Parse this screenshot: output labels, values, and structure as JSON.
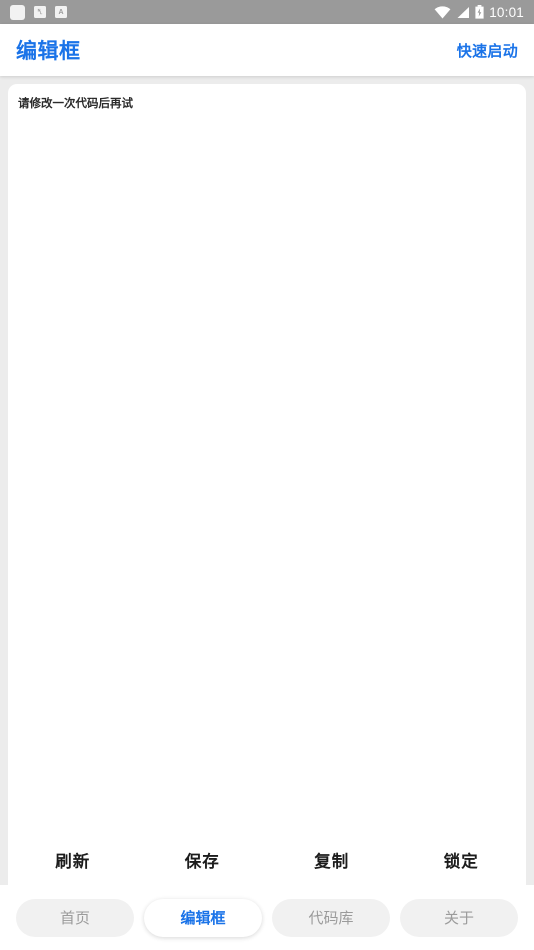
{
  "status_bar": {
    "background_color": "#9a9a9a",
    "time": "10:01",
    "left_icons": [
      {
        "name": "app-notification-icon",
        "glyph": ""
      },
      {
        "name": "keyboard-notification-icon",
        "glyph": "⌨"
      },
      {
        "name": "text-input-notification-icon",
        "glyph": "A"
      }
    ],
    "right_icons": [
      {
        "name": "wifi-icon"
      },
      {
        "name": "cellular-signal-icon"
      },
      {
        "name": "battery-charging-icon"
      }
    ]
  },
  "header": {
    "title": "编辑框",
    "quick_launch_label": "快速启动",
    "accent_color": "#1a73e8"
  },
  "editor": {
    "value": "请修改一次代码后再试",
    "placeholder": "请修改一次代码后再试"
  },
  "actions": [
    {
      "name": "refresh-button",
      "label": "刷新"
    },
    {
      "name": "save-button",
      "label": "保存"
    },
    {
      "name": "copy-button",
      "label": "复制"
    },
    {
      "name": "lock-button",
      "label": "锁定"
    }
  ],
  "tabs": [
    {
      "name": "tab-home",
      "label": "首页",
      "active": false
    },
    {
      "name": "tab-editor",
      "label": "编辑框",
      "active": true
    },
    {
      "name": "tab-code-library",
      "label": "代码库",
      "active": false
    },
    {
      "name": "tab-about",
      "label": "关于",
      "active": false
    }
  ]
}
